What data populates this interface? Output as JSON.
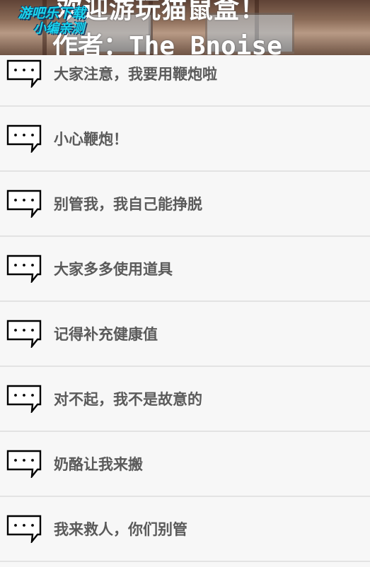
{
  "banner": {
    "title": "欢迎游玩猫鼠盒！",
    "author": "作者：The_Bnoise",
    "watermark_line1": "游吧乐下载",
    "watermark_line2": "小编亲测"
  },
  "messages": [
    {
      "label": "大家注意，我要用鞭炮啦",
      "icon": "chat-bubble-icon"
    },
    {
      "label": "小心鞭炮！",
      "icon": "chat-bubble-icon"
    },
    {
      "label": "别管我，我自己能挣脱",
      "icon": "chat-bubble-icon"
    },
    {
      "label": "大家多多使用道具",
      "icon": "chat-bubble-icon"
    },
    {
      "label": "记得补充健康值",
      "icon": "chat-bubble-icon"
    },
    {
      "label": "对不起，我不是故意的",
      "icon": "chat-bubble-icon"
    },
    {
      "label": "奶酪让我来搬",
      "icon": "chat-bubble-icon"
    },
    {
      "label": "我来救人，你们别管",
      "icon": "chat-bubble-icon"
    }
  ],
  "colors": {
    "background": "#f7f7f7",
    "divider": "#e3e3e3",
    "text": "#5a5a5a",
    "watermark": "#19d6f0"
  }
}
